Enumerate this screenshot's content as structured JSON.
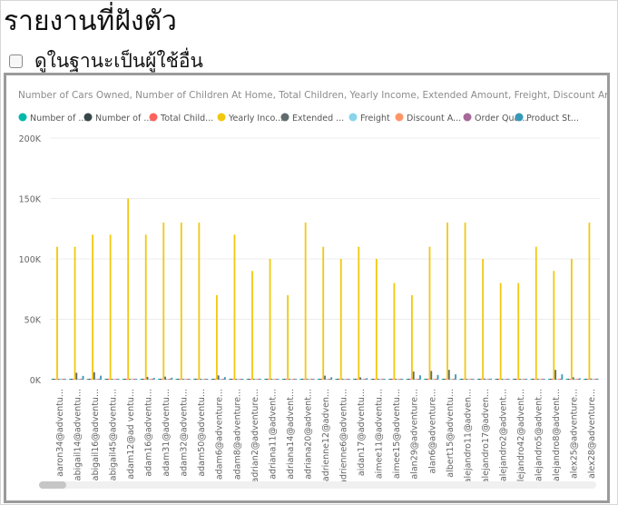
{
  "page": {
    "title": "รายงานที่ฝังตัว",
    "view_as_label": "ดูในฐานะเป็นผู้ใช้อื่น"
  },
  "chart_data": {
    "type": "bar",
    "title": "Number of Cars Owned, Number of Children At Home, Total Children, Yearly Income, Extended Amount, Freight, Discount Am...",
    "legend": [
      {
        "label": "Number of ...",
        "color": "#01B8AA"
      },
      {
        "label": "Number of ...",
        "color": "#374649"
      },
      {
        "label": "Total Child...",
        "color": "#FD625E"
      },
      {
        "label": "Yearly Inco...",
        "color": "#F2C80F"
      },
      {
        "label": "Extended ...",
        "color": "#5F6B6D"
      },
      {
        "label": "Freight",
        "color": "#8AD4EB"
      },
      {
        "label": "Discount A...",
        "color": "#FE9666"
      },
      {
        "label": "Order Qua...",
        "color": "#A66999"
      },
      {
        "label": "Product St...",
        "color": "#3599B8"
      }
    ],
    "ylim": [
      0,
      200000
    ],
    "y_ticks": [
      {
        "value": 0,
        "label": "0K"
      },
      {
        "value": 50000,
        "label": "50K"
      },
      {
        "value": 100000,
        "label": "100K"
      },
      {
        "value": 150000,
        "label": "150K"
      },
      {
        "value": 200000,
        "label": "200K"
      }
    ],
    "grid": true,
    "categories": [
      "aaron34@adventu...",
      "abigail14@adventu...",
      "abigail16@adventu...",
      "abigail45@adventu...",
      "adam12@ad ventu...",
      "adam16@adventu...",
      "adam31@adventu...",
      "adam32@adventu...",
      "adam50@adventu...",
      "adam6@adventure...",
      "adam8@adventure...",
      "adrian2@adventure...",
      "adriana11@advent...",
      "adriana14@advent...",
      "adriana20@advent...",
      "adrienne12@adven...",
      "adrienne6@adventu...",
      "aidan17@adventu...",
      "aimee11@adventu...",
      "aimee15@adventu...",
      "alan29@adventure...",
      "alan6@adventure...",
      "albert15@adventu...",
      "alejandro11@adven...",
      "alejandro17@adven...",
      "alejandro2@advent...",
      "alejandro42@advent...",
      "alejandro5@advent...",
      "alejandro8@advent...",
      "alex25@adventure...",
      "alex28@adventure..."
    ],
    "series": [
      {
        "name": "Number of ...",
        "values": [
          1,
          2,
          0,
          2,
          1,
          0,
          1,
          1,
          2,
          1,
          0,
          2,
          1,
          2,
          1,
          2,
          0,
          1,
          2,
          1,
          1,
          2,
          0,
          1,
          2,
          1,
          0,
          2,
          1,
          1,
          2
        ]
      },
      {
        "name": "Number of ...",
        "values": [
          0,
          0,
          0,
          0,
          1,
          0,
          0,
          0,
          0,
          0,
          0,
          0,
          0,
          0,
          0,
          0,
          0,
          0,
          0,
          0,
          0,
          0,
          1,
          0,
          0,
          0,
          0,
          0,
          0,
          0,
          0
        ]
      },
      {
        "name": "Total Child...",
        "values": [
          2,
          2,
          1,
          2,
          3,
          1,
          2,
          2,
          3,
          1,
          0,
          3,
          1,
          2,
          3,
          3,
          1,
          2,
          3,
          1,
          4,
          3,
          4,
          2,
          3,
          1,
          0,
          2,
          2,
          2,
          3
        ]
      },
      {
        "name": "Yearly Inco...",
        "values": [
          110000,
          110000,
          120000,
          120000,
          150000,
          120000,
          130000,
          130000,
          130000,
          70000,
          120000,
          90000,
          100000,
          70000,
          130000,
          110000,
          100000,
          110000,
          100000,
          80000,
          70000,
          110000,
          130000,
          130000,
          100000,
          80000,
          80000,
          110000,
          90000,
          100000,
          130000
        ]
      },
      {
        "name": "Extended ...",
        "values": [
          700,
          5700,
          6100,
          500,
          300,
          2300,
          2500,
          600,
          700,
          3500,
          200,
          400,
          300,
          300,
          500,
          3300,
          200,
          1900,
          300,
          200,
          6700,
          7200,
          8100,
          700,
          900,
          100,
          200,
          300,
          8100,
          2000,
          900
        ]
      },
      {
        "name": "Freight",
        "values": [
          20,
          140,
          150,
          15,
          10,
          60,
          60,
          20,
          20,
          90,
          5,
          10,
          10,
          10,
          15,
          80,
          5,
          50,
          10,
          5,
          170,
          180,
          200,
          20,
          25,
          3,
          5,
          10,
          200,
          50,
          25
        ]
      },
      {
        "name": "Discount A...",
        "values": [
          0,
          0,
          0,
          0,
          0,
          0,
          0,
          0,
          0,
          0,
          0,
          0,
          0,
          0,
          0,
          0,
          0,
          0,
          0,
          0,
          0,
          0,
          0,
          0,
          0,
          0,
          0,
          0,
          0,
          0,
          0
        ]
      },
      {
        "name": "Order Qua...",
        "values": [
          2,
          3,
          3,
          1,
          1,
          2,
          2,
          1,
          1,
          2,
          1,
          1,
          1,
          1,
          1,
          2,
          1,
          2,
          1,
          1,
          3,
          3,
          4,
          1,
          2,
          1,
          1,
          1,
          3,
          2,
          1
        ]
      },
      {
        "name": "Product St...",
        "values": [
          700,
          3100,
          3300,
          500,
          300,
          1500,
          1600,
          600,
          700,
          2100,
          200,
          400,
          300,
          300,
          500,
          2000,
          200,
          1200,
          300,
          200,
          3600,
          3900,
          4400,
          700,
          900,
          100,
          200,
          300,
          4400,
          1200,
          900
        ]
      }
    ]
  }
}
